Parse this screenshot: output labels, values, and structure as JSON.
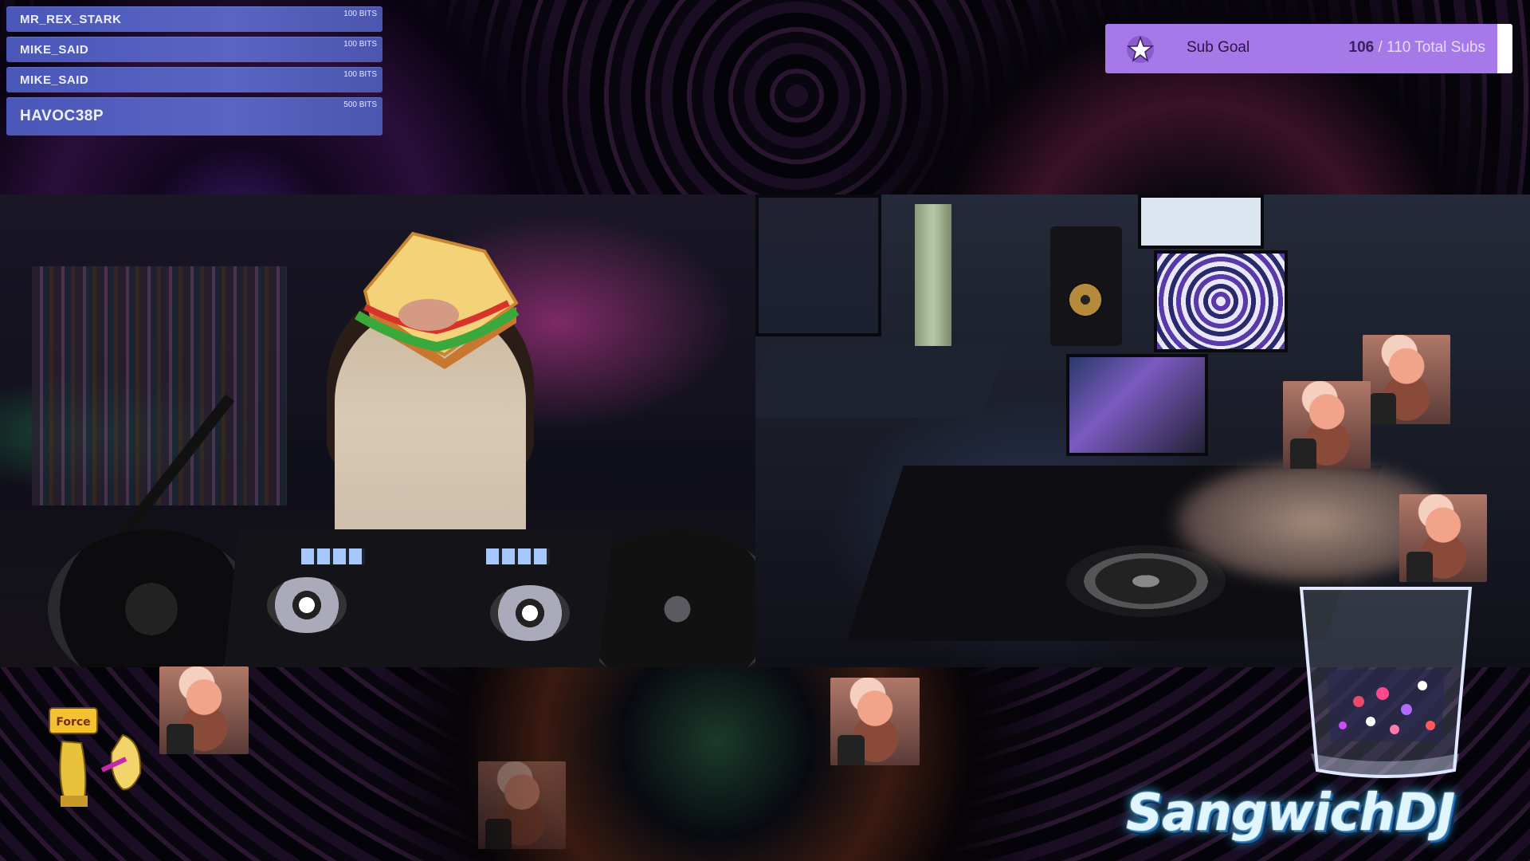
{
  "bits_feed": [
    {
      "user": "MR_REX_STARK",
      "amount": "100 BITS"
    },
    {
      "user": "MIKE_SAID",
      "amount": "100 BITS"
    },
    {
      "user": "MIKE_SAID",
      "amount": "100 BITS"
    },
    {
      "user": "HAVOC38P",
      "amount": "500 BITS"
    }
  ],
  "sub_goal": {
    "label": "Sub Goal",
    "current": "106",
    "total_text": "/ 110 Total Subs",
    "progress": 0.9636,
    "icon": "star-icon"
  },
  "emote": {
    "text": "Force",
    "icon": "fist-icon"
  },
  "channel": {
    "logo_text": "SangwichDJ"
  },
  "colors": {
    "bits_row": "#5a64c2",
    "sub_goal_bar": "#a678e8",
    "logo_glow": "#3ac4ff"
  }
}
